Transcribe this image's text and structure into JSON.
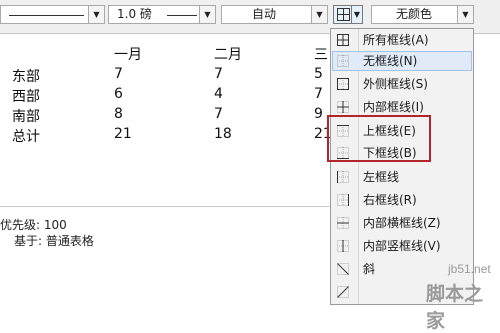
{
  "toolbar": {
    "line_width": "1.0 磅",
    "auto_color": "自动",
    "fill_color": "无颜色"
  },
  "table": {
    "headers": [
      "一月",
      "二月",
      "三"
    ],
    "rows": [
      {
        "label": "东部",
        "values": [
          "7",
          "7",
          "5"
        ]
      },
      {
        "label": "西部",
        "values": [
          "6",
          "4",
          "7"
        ]
      },
      {
        "label": "南部",
        "values": [
          "8",
          "7",
          "9"
        ]
      },
      {
        "label": "总计",
        "values": [
          "21",
          "18",
          "21"
        ]
      }
    ]
  },
  "properties": {
    "priority": "优先级: 100",
    "based_on": "基于: 普通表格"
  },
  "border_menu": {
    "items": [
      {
        "label": "所有框线(A)",
        "icon": "all-borders-icon"
      },
      {
        "label": "无框线(N)",
        "icon": "no-border-icon",
        "highlighted": true
      },
      {
        "label": "外侧框线(S)",
        "icon": "outside-borders-icon"
      },
      {
        "label": "内部框线(I)",
        "icon": "inside-borders-icon"
      },
      {
        "label": "上框线(E)",
        "icon": "top-border-icon"
      },
      {
        "label": "下框线(B)",
        "icon": "bottom-border-icon"
      },
      {
        "label": "左框线",
        "icon": "left-border-icon"
      },
      {
        "label": "右框线(R)",
        "icon": "right-border-icon"
      },
      {
        "label": "内部横框线(Z)",
        "icon": "inside-horizontal-border-icon"
      },
      {
        "label": "内部竖框线(V)",
        "icon": "inside-vertical-border-icon"
      },
      {
        "label": "斜",
        "icon": "diagonal-down-border-icon"
      },
      {
        "label": "",
        "icon": "diagonal-up-border-icon"
      }
    ]
  },
  "watermark": {
    "site": "jb51.net",
    "name": "脚本之家"
  },
  "colors": {
    "highlight_outline": "#b0262b",
    "menu_hover": "#e0ebf7"
  }
}
